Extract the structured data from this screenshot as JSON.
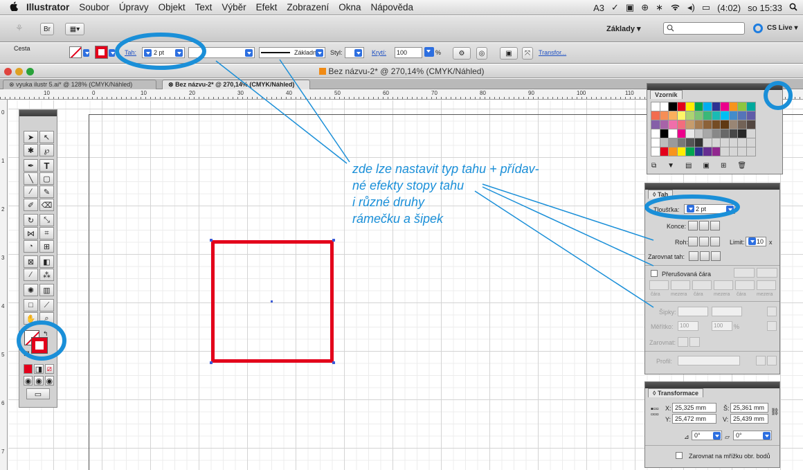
{
  "menubar": {
    "apple": "",
    "app": "Illustrator",
    "items": [
      "Soubor",
      "Úpravy",
      "Objekt",
      "Text",
      "Výběr",
      "Efekt",
      "Zobrazení",
      "Okna",
      "Nápověda"
    ],
    "tray": {
      "adobe": "A3",
      "battery": "(4:02)",
      "clock": "so 15:33"
    }
  },
  "appbar": {
    "bridge": "Br",
    "workspace": "Základy ▾",
    "cslive": "CS Live ▾"
  },
  "control": {
    "selection": "Cesta",
    "stroke_label": "Tah:",
    "stroke_weight": "2 pt",
    "brush": "Základní",
    "style_label": "Styl:",
    "opacity_label": "Krytí:",
    "opacity": "100",
    "percent": "%",
    "transform_link": "Transfor..."
  },
  "document": {
    "title": "Bez názvu-2* @ 270,14% (CMYK/Náhled)"
  },
  "tabs": [
    {
      "label": "vyuka ilustr 5.ai* @ 128% (CMYK/Náhled)"
    },
    {
      "label": "Bez názvu-2* @ 270,14% (CMYK/Náhled)"
    }
  ],
  "ruler": {
    "h": [
      "10",
      "0",
      "10",
      "20",
      "30",
      "40",
      "50",
      "60",
      "70",
      "80",
      "90",
      "100",
      "110"
    ],
    "v": [
      "0",
      "1",
      "2",
      "3",
      "4",
      "5",
      "6",
      "7"
    ]
  },
  "annotation": {
    "lines": [
      "zde lze nastavit typ tahu + přídav-",
      "né efekty stopy tahu",
      "i různé druhy",
      "rámečku a šipek"
    ]
  },
  "swatches_panel": {
    "tab": "Vzorník"
  },
  "stroke_panel": {
    "tab": "◊ Tah",
    "weight_label": "Tloušťka:",
    "weight": "2 pt",
    "cap_label": "Konce:",
    "corner_label": "Roh:",
    "limit_label": "Limit:",
    "limit": "10",
    "limit_unit": "x",
    "align_label": "Zarovnat tah:",
    "dashed": "Přerušovaná čára",
    "dash_cols": [
      "čára",
      "mezera",
      "čára",
      "mezera",
      "čára",
      "mezera"
    ],
    "arrows_label": "Šipky:",
    "scale_label": "Měřítko:",
    "scale1": "100",
    "scale2": "100",
    "pct": "%",
    "align2_label": "Zarovnat:",
    "profile_label": "Profil:"
  },
  "transform_panel": {
    "tab": "◊ Transformace",
    "x_label": "X:",
    "x": "25,325 mm",
    "y_label": "Y:",
    "y": "25,472 mm",
    "w_label": "Š:",
    "w": "25,361 mm",
    "h_label": "V:",
    "h": "25,439 mm",
    "angle": "0°",
    "shear": "0°",
    "snap": "Zarovnat na mřížku obr. bodů"
  },
  "colors": {
    "accent": "#1a8fd8",
    "stroke_red": "#e3001b",
    "selection_blue": "#3b5bd8"
  }
}
